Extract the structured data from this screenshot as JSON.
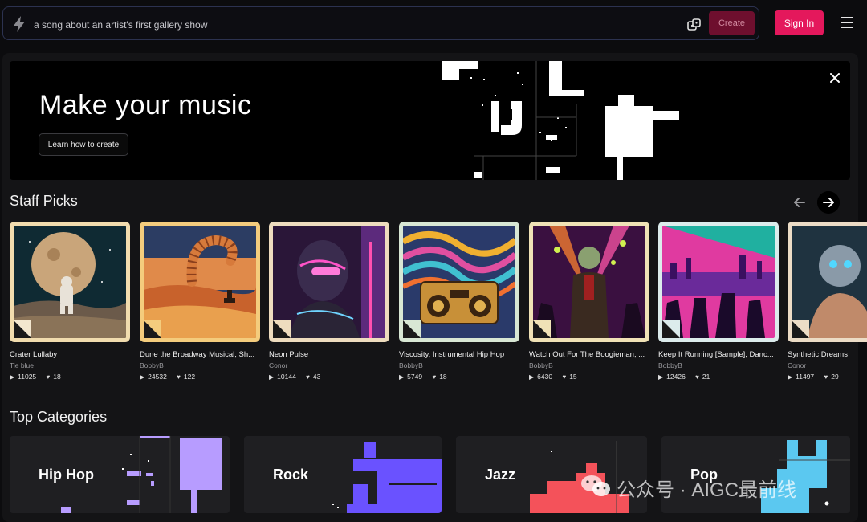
{
  "search": {
    "placeholder": "a song about an artist's first gallery show",
    "create_label": "Create"
  },
  "header": {
    "sign_in_label": "Sign In"
  },
  "hero": {
    "title": "Make your music",
    "button_label": "Learn how to create"
  },
  "staff_picks": {
    "heading": "Staff Picks",
    "cards": [
      {
        "title": "Crater Lullaby",
        "artist": "Tie blue",
        "plays": "11025",
        "likes": "18",
        "border": "#f1dcae"
      },
      {
        "title": "Dune the Broadway Musical, Sh...",
        "artist": "BobbyB",
        "plays": "24532",
        "likes": "122",
        "border": "#f4cc7d"
      },
      {
        "title": "Neon Pulse",
        "artist": "Conor",
        "plays": "10144",
        "likes": "43",
        "border": "#eedcbe"
      },
      {
        "title": "Viscosity, Instrumental Hip Hop",
        "artist": "BobbyB",
        "plays": "5749",
        "likes": "18",
        "border": "#d8e7d4"
      },
      {
        "title": "Watch Out For The Boogieman, ...",
        "artist": "BobbyB",
        "plays": "6430",
        "likes": "15",
        "border": "#f0e2b6"
      },
      {
        "title": "Keep It Running [Sample], Danc...",
        "artist": "BobbyB",
        "plays": "12426",
        "likes": "21",
        "border": "#dcecec"
      },
      {
        "title": "Synthetic Dreams",
        "artist": "Conor",
        "plays": "11497",
        "likes": "29",
        "border": "#ecdcc6"
      }
    ]
  },
  "top_categories": {
    "heading": "Top Categories",
    "items": [
      {
        "label": "Hip Hop",
        "accent": "#b79cff"
      },
      {
        "label": "Rock",
        "accent": "#6a52ff"
      },
      {
        "label": "Jazz",
        "accent": "#f4525a"
      },
      {
        "label": "Pop",
        "accent": "#5bc8f0"
      }
    ]
  },
  "watermark": {
    "text": "公众号 · AIGC最前线"
  },
  "colors": {
    "accent": "#e4185c",
    "background": "#0c0c0e",
    "panel": "#141416"
  }
}
